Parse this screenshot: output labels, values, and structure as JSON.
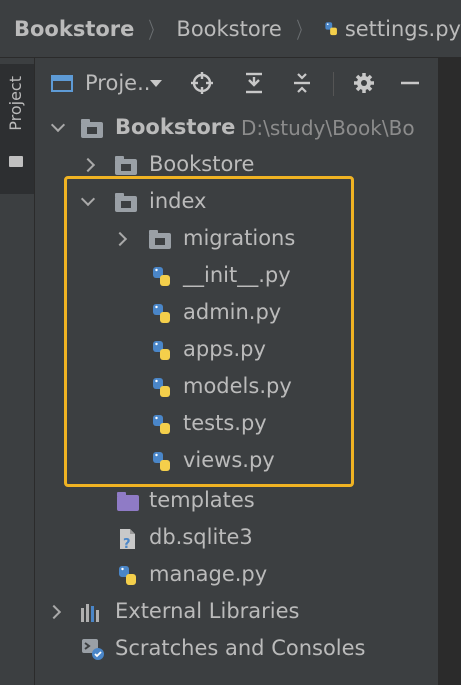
{
  "breadcrumb": {
    "items": [
      "Bookstore",
      "Bookstore",
      "settings.py"
    ]
  },
  "side_strip": {
    "project_tab": "Project"
  },
  "toolbar": {
    "view_label": "Proje..",
    "icons": [
      "project-window-icon",
      "dropdown-arrow-icon",
      "target-icon",
      "collapse-all-icon",
      "expand-all-icon",
      "gear-icon",
      "minimize-icon"
    ]
  },
  "tree": {
    "root": {
      "name": "Bookstore",
      "path": "D:\\study\\Book\\Bo"
    },
    "rows": [
      {
        "label": "Bookstore",
        "kind": "folder",
        "expanded": false
      },
      {
        "label": "index",
        "kind": "folder",
        "expanded": true
      },
      {
        "label": "migrations",
        "kind": "folder",
        "expanded": false
      },
      {
        "label": "__init__.py",
        "kind": "python"
      },
      {
        "label": "admin.py",
        "kind": "python"
      },
      {
        "label": "apps.py",
        "kind": "python"
      },
      {
        "label": "models.py",
        "kind": "python"
      },
      {
        "label": "tests.py",
        "kind": "python"
      },
      {
        "label": "views.py",
        "kind": "python"
      },
      {
        "label": "templates",
        "kind": "folder-templates"
      },
      {
        "label": "db.sqlite3",
        "kind": "database"
      },
      {
        "label": "manage.py",
        "kind": "python"
      },
      {
        "label": "External Libraries",
        "kind": "libraries",
        "expanded": false
      },
      {
        "label": "Scratches and Consoles",
        "kind": "scratches"
      }
    ]
  },
  "colors": {
    "background": "#3c3f41",
    "highlight": "#f0b323",
    "python_blue": "#4a86c8",
    "python_yellow": "#f4cf4b",
    "templates_folder": "#8f7bc6"
  }
}
